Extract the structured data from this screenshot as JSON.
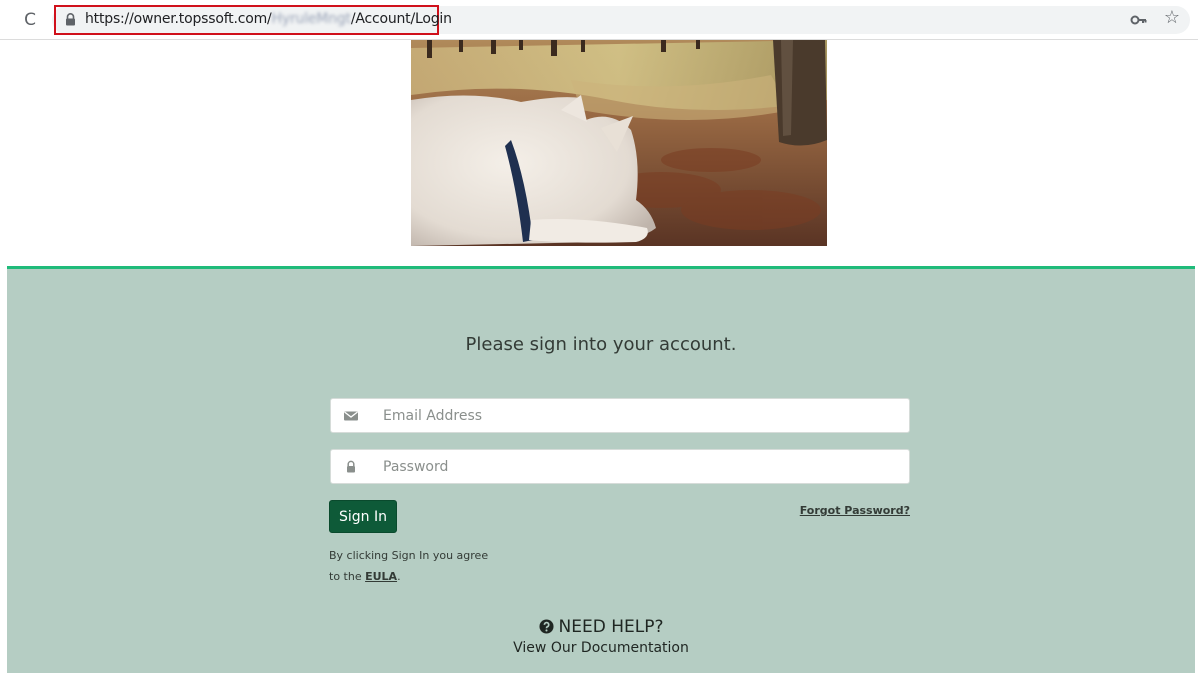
{
  "browser": {
    "url_prefix": "https://owner.topssoft.com/",
    "url_blurred": "HyruleMngt",
    "url_suffix": "/Account/Login",
    "reload_glyph": "C",
    "icons": {
      "reload": "reload-icon",
      "lock": "lock-icon",
      "key": "key-icon",
      "star": "star-icon"
    },
    "highlight_color": "#d0101b"
  },
  "login": {
    "heading": "Please sign into your account.",
    "email_placeholder": "Email Address",
    "password_placeholder": "Password",
    "signin_label": "Sign In",
    "forgot_label": "Forgot Password?",
    "terms_prefix": "By clicking Sign In you agree to the ",
    "eula_label": "EULA",
    "terms_suffix": ".",
    "help_label": "NEED HELP?",
    "docs_label": "View Our Documentation"
  },
  "colors": {
    "panel_bg": "#b5cdc3",
    "accent_border": "#1fbb7a",
    "button_bg": "#0e5a38"
  }
}
